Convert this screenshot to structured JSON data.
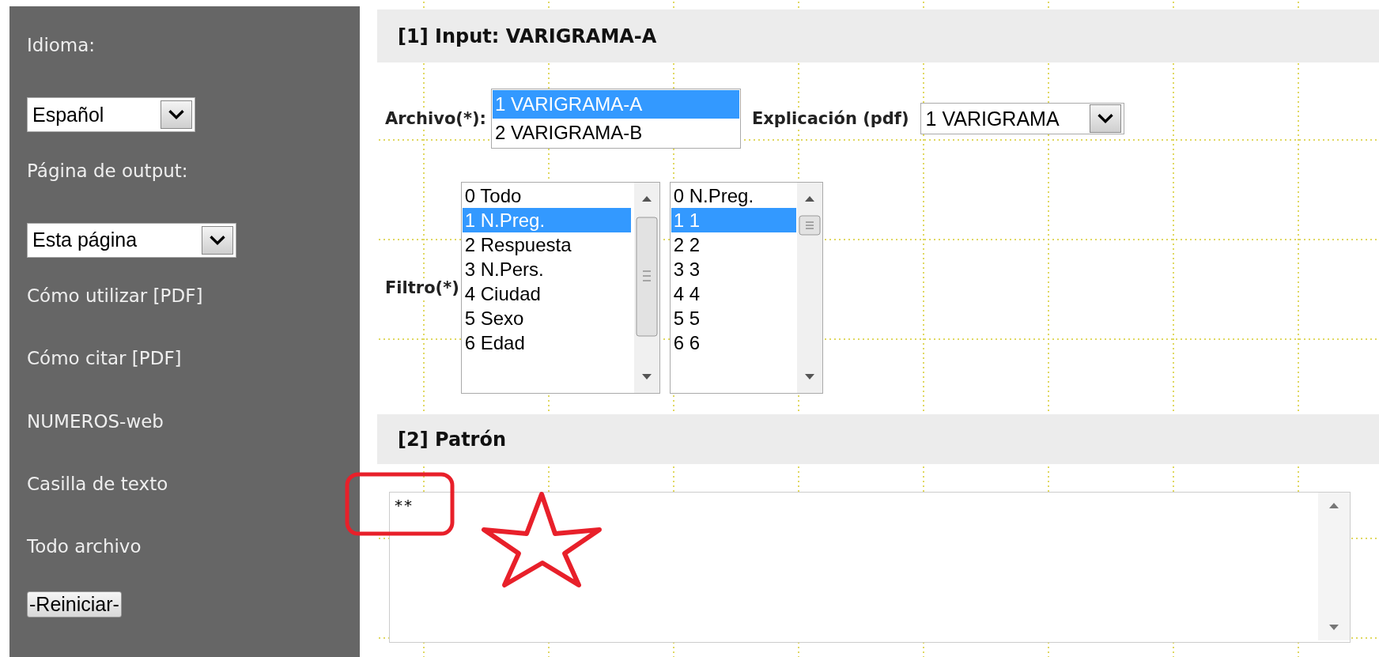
{
  "sidebar": {
    "items": [
      {
        "kind": "label",
        "text": "Idioma:"
      },
      {
        "kind": "select",
        "value": "Español"
      },
      {
        "kind": "label",
        "text": "Página de output:"
      },
      {
        "kind": "select",
        "value": "Esta página"
      },
      {
        "kind": "link",
        "text": "Cómo utilizar [PDF]"
      },
      {
        "kind": "link",
        "text": "Cómo citar [PDF]"
      },
      {
        "kind": "link",
        "text": "NUMEROS-web"
      },
      {
        "kind": "link",
        "text": "Casilla de texto"
      },
      {
        "kind": "link",
        "text": "Todo archivo"
      },
      {
        "kind": "button",
        "text": "-Reiniciar-"
      }
    ]
  },
  "input_section": {
    "title": "[1] Input: VARIGRAMA-A",
    "archivo": {
      "label": "Archivo(*):",
      "options": [
        {
          "text": "1 VARIGRAMA-A",
          "selected": true
        },
        {
          "text": "2 VARIGRAMA-B",
          "selected": false
        }
      ]
    },
    "explicacion": {
      "label": "Explicación (pdf)",
      "value": "1 VARIGRAMA"
    },
    "filtro": {
      "label": "Filtro(*)",
      "list_1": [
        {
          "text": "0 Todo",
          "selected": false
        },
        {
          "text": "1 N.Preg.",
          "selected": true
        },
        {
          "text": "2 Respuesta",
          "selected": false
        },
        {
          "text": "3 N.Pers.",
          "selected": false
        },
        {
          "text": "4 Ciudad",
          "selected": false
        },
        {
          "text": "5 Sexo",
          "selected": false
        },
        {
          "text": "6 Edad",
          "selected": false
        }
      ],
      "list_2": [
        {
          "text": "0 N.Preg.",
          "selected": false
        },
        {
          "text": "1 1",
          "selected": true
        },
        {
          "text": "2 2",
          "selected": false
        },
        {
          "text": "3 3",
          "selected": false
        },
        {
          "text": "4 4",
          "selected": false
        },
        {
          "text": "5 5",
          "selected": false
        },
        {
          "text": "6 6",
          "selected": false
        }
      ]
    }
  },
  "pattern_section": {
    "title": "[2] Patrón",
    "value": "**"
  }
}
